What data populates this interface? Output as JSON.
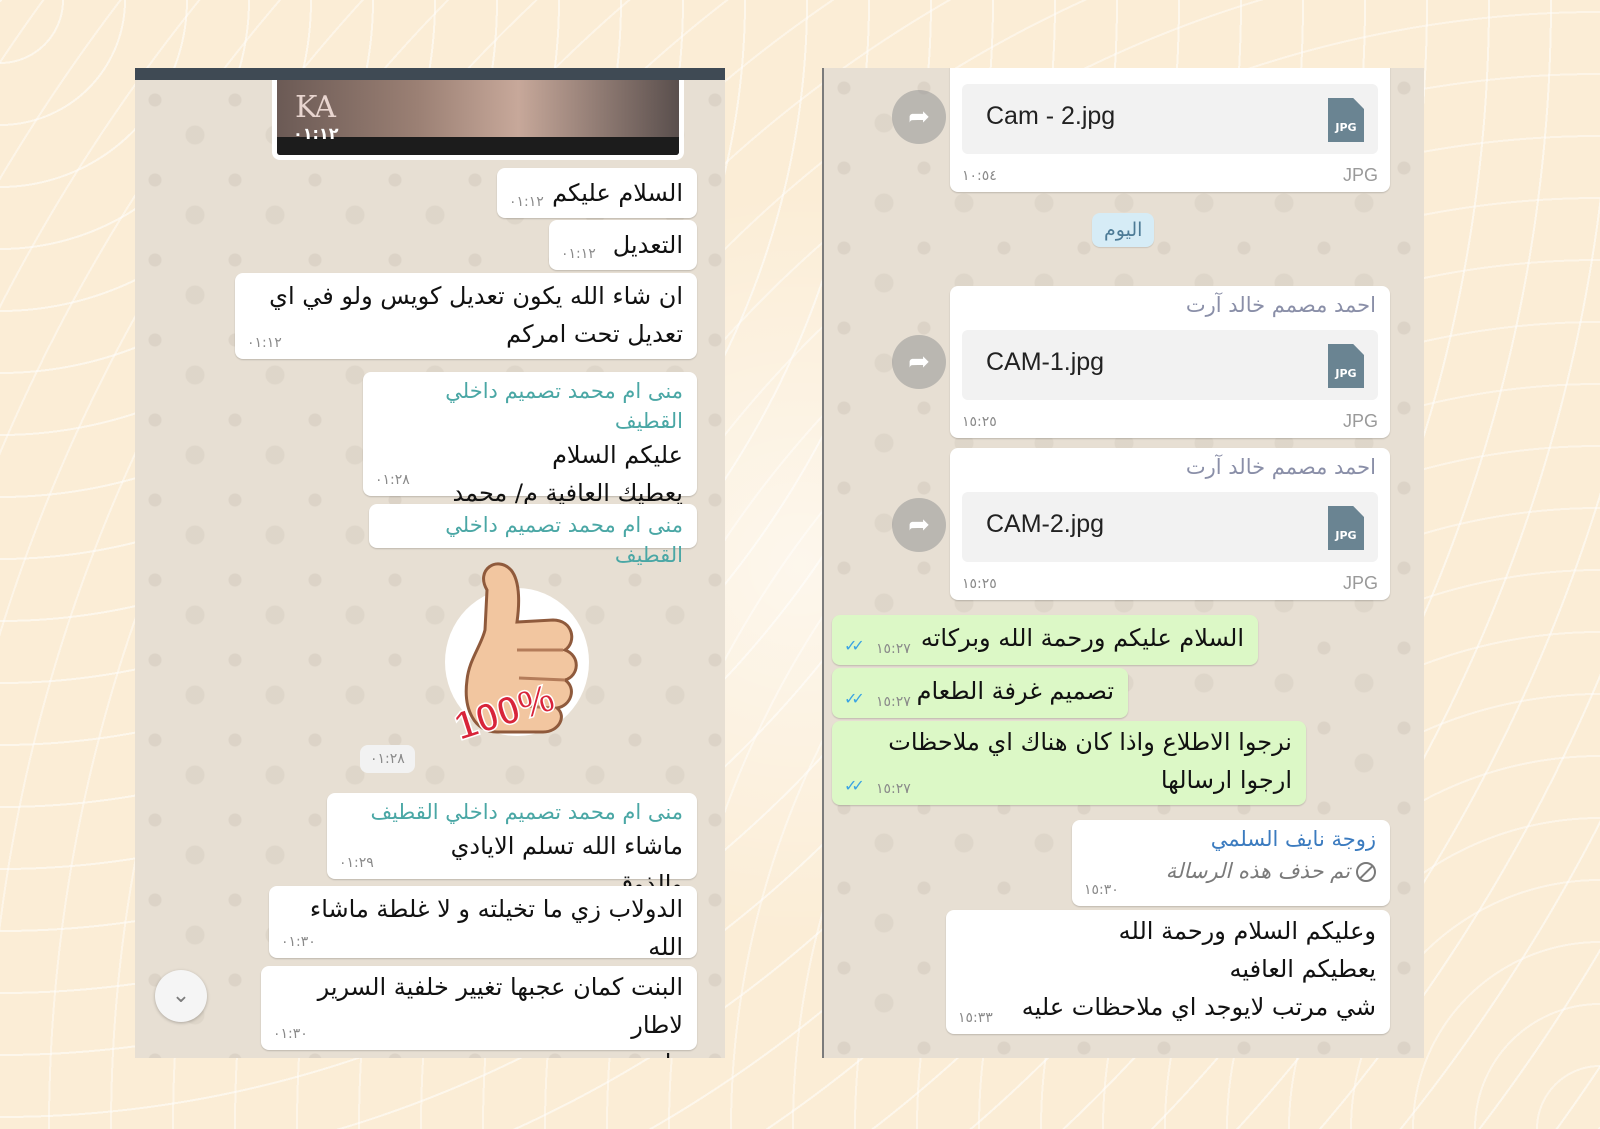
{
  "left_chat": {
    "image_message": {
      "time": "٠١:١٢"
    },
    "messages": [
      {
        "text": "السلام عليكم",
        "time": "٠١:١٢"
      },
      {
        "text": "التعديل",
        "time": "٠١:١٢"
      },
      {
        "line1": "ان شاء الله يكون تعديل كويس ولو في اي",
        "line2": "تعديل تحت امركم",
        "time": "٠١:١٢"
      },
      {
        "sender": "منى ام محمد تصميم داخلي القطيف",
        "line1": "عليكم السلام",
        "line2": "يعطيك العافية م/ محمد",
        "time": "٠١:٢٨"
      },
      {
        "sender": "منى ام محمد تصميم داخلي القطيف"
      },
      {
        "sender": "منى ام محمد تصميم داخلي القطيف",
        "text": "ماشاء الله تسلم الايادي والذوق",
        "time": "٠١:٢٩"
      },
      {
        "text": "الدولاب زي ما تخيلته و لا غلطة ماشاء الله",
        "time": "٠١:٣٠"
      },
      {
        "line1": "البنت كمان عجبها تغيير خلفية السرير لاطار",
        "line2": "واحد",
        "time": "٠١:٣٠"
      }
    ],
    "sticker": {
      "label": "100%",
      "time": "٠١:٢٨"
    }
  },
  "right_chat": {
    "files": [
      {
        "name": "Cam - 2.jpg",
        "type": "JPG",
        "icon_label": "JPG",
        "time": "١٠:٥٤"
      },
      {
        "sender": "احمد مصمم خالد آرت",
        "name": "CAM-1.jpg",
        "type": "JPG",
        "icon_label": "JPG",
        "time": "١٥:٢٥"
      },
      {
        "sender": "احمد مصمم خالد آرت",
        "name": "CAM-2.jpg",
        "type": "JPG",
        "icon_label": "JPG",
        "time": "١٥:٢٥"
      }
    ],
    "date_chip": "اليوم",
    "outgoing": [
      {
        "text": "السلام عليكم ورحمة الله وبركاته",
        "time": "١٥:٢٧"
      },
      {
        "text": "تصميم غرفة الطعام",
        "time": "١٥:٢٧"
      },
      {
        "line1": "نرجوا الاطلاع واذا كان هناك اي ملاحظات",
        "line2": "ارجوا ارسالها",
        "time": "١٥:٢٧"
      }
    ],
    "deleted": {
      "sender": "زوجة نايف السلمي",
      "text": "تم حذف هذه الرسالة",
      "time": "١٥:٣٠"
    },
    "last": {
      "line1": "وعليكم السلام ورحمة الله",
      "line2": "يعطيكم العافيه",
      "line3": "شي مرتب لايوجد اي ملاحظات عليه",
      "time": "١٥:٣٣"
    }
  },
  "colors": {
    "outgoing_bubble": "#dcf8c6",
    "incoming_bubble": "#ffffff",
    "sender_teal": "#4aa7a5",
    "read_ticks": "#3aa3e3"
  }
}
